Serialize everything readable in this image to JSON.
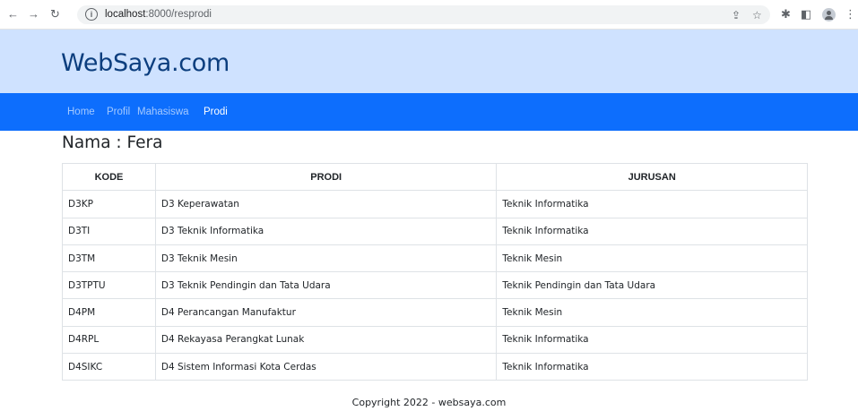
{
  "browser": {
    "back_icon": "arrow-left-icon",
    "forward_icon": "arrow-right-icon",
    "reload_icon": "reload-icon",
    "url_host": "localhost",
    "url_path": ":8000/resprodi"
  },
  "header": {
    "site_title": "WebSaya.com"
  },
  "nav": {
    "items": [
      {
        "label": "Home"
      },
      {
        "label": "Profil"
      },
      {
        "label": "Mahasiswa"
      },
      {
        "label": "Prodi"
      }
    ],
    "active": "Prodi"
  },
  "main": {
    "heading": "Nama : Fera",
    "table": {
      "headers": [
        "KODE",
        "PRODI",
        "JURUSAN"
      ],
      "rows": [
        [
          "D3KP",
          "D3 Keperawatan",
          "Teknik Informatika"
        ],
        [
          "D3TI",
          "D3 Teknik Informatika",
          "Teknik Informatika"
        ],
        [
          "D3TM",
          "D3 Teknik Mesin",
          "Teknik Mesin"
        ],
        [
          "D3TPTU",
          "D3 Teknik Pendingin dan Tata Udara",
          "Teknik Pendingin dan Tata Udara"
        ],
        [
          "D4PM",
          "D4 Perancangan Manufaktur",
          "Teknik Mesin"
        ],
        [
          "D4RPL",
          "D4 Rekayasa Perangkat Lunak",
          "Teknik Informatika"
        ],
        [
          "D4SIKC",
          "D4 Sistem Informasi Kota Cerdas",
          "Teknik Informatika"
        ]
      ]
    }
  },
  "footer": {
    "text": "Copyright 2022 - websaya.com"
  },
  "colors": {
    "header_bg": "#cfe2ff",
    "nav_bg": "#0d6efd",
    "title_color": "#0c3e7e"
  }
}
